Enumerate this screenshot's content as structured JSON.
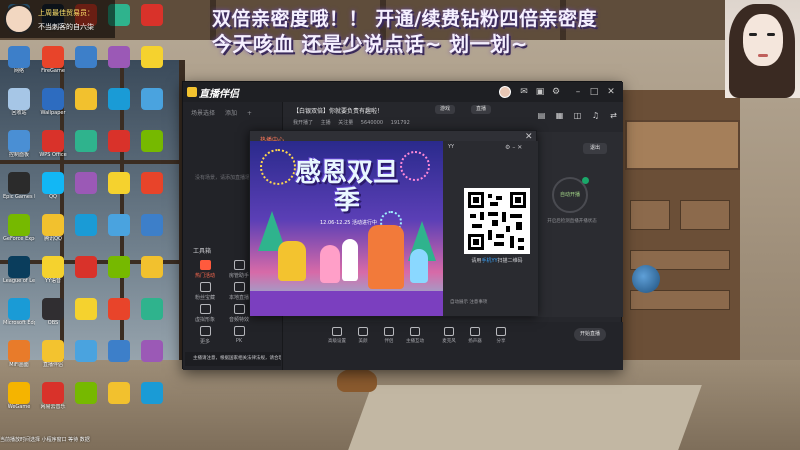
{
  "overlay": {
    "streamer_line1": "上周最佳贸易员：",
    "streamer_line2": "不当刺客的自六柒",
    "headline1": "双倍亲密度哦！！ 开通/续费钻粉四倍亲密度",
    "headline2": "今天咳血 还是少说点话~ 划一划~"
  },
  "desktop_icons": [
    {
      "label": "此电脑",
      "color": "#4aa3df"
    },
    {
      "label": "网络",
      "color": "#3d7fc9"
    },
    {
      "label": "回收站",
      "color": "#a6c6e6"
    },
    {
      "label": "控制面板",
      "color": "#4a8fd4"
    },
    {
      "label": "Epic Games Launcher",
      "color": "#2b2b2b"
    },
    {
      "label": "GeForce Experience",
      "color": "#76b900"
    },
    {
      "label": "League of Legends",
      "color": "#0a3d5c"
    },
    {
      "label": "Microsoft Edge",
      "color": "#1a9bd6"
    },
    {
      "label": "MiFi画面",
      "color": "#e87b2a"
    },
    {
      "label": "WeGame",
      "color": "#f5b400"
    },
    {
      "label": "Steam",
      "color": "#1b2838"
    },
    {
      "label": "FireGame",
      "color": "#e8442a"
    },
    {
      "label": "Wallpaper",
      "color": "#2d6cc0"
    },
    {
      "label": "WPS Office",
      "color": "#d9322a"
    },
    {
      "label": "QQ",
      "color": "#12b7f5"
    },
    {
      "label": "腾讯QQ",
      "color": "#f2c12e"
    },
    {
      "label": "YY语音",
      "color": "#f5d22e"
    },
    {
      "label": "OBS",
      "color": "#302e31"
    },
    {
      "label": "直播伴侣",
      "color": "#f3c32f"
    },
    {
      "label": "网易云音乐",
      "color": "#d9322a"
    }
  ],
  "app": {
    "title": "直播伴侣",
    "left_tabs": [
      "场景选择",
      "添加",
      "+"
    ],
    "empty_hint": "没有场景，请添加直播场景",
    "tools_title": "工具箱",
    "tools": [
      {
        "label": "热门活动",
        "highlight": true
      },
      {
        "label": "房管助手",
        "highlight": false
      },
      {
        "label": "粉丝宝藏",
        "highlight": false
      },
      {
        "label": "本地直播",
        "highlight": false
      },
      {
        "label": "虚拟形象",
        "highlight": false
      },
      {
        "label": "音频特效",
        "highlight": false
      },
      {
        "label": "更多",
        "highlight": false
      },
      {
        "label": "PK",
        "highlight": false
      }
    ],
    "notice": "主播请注意，根据国家相关法律法规，请合理直播与直播",
    "room": {
      "name": "【白银双倍】你就要负责有趣啦！",
      "pill_category": "游戏",
      "pill_edit": "直播",
      "stats": [
        "我开播了",
        "主播 ",
        "关注量 ",
        "5640000",
        "191792"
      ]
    },
    "exit_label": "退出",
    "autogo": "自动开播",
    "autogo_desc": "开启后检测直播开播状态",
    "bottom_items": [
      "高级设置",
      "美颜",
      "伴侣",
      "主播互动",
      "麦克风",
      "扬声器",
      "分享"
    ],
    "golive": "开始直播"
  },
  "popup": {
    "title": "热播中心",
    "banner_title": "感恩双旦季",
    "banner_sub": "12.06-12.25 活动进行中",
    "qr_title": "YY",
    "qr_caption_prefix": "请用",
    "qr_caption_hl": "手机YY",
    "qr_caption_suffix": "扫描二维码",
    "qr_bottom": "自动展示  注意事项"
  },
  "taskbar_hint": "当前播放时间选择  小程序窗口  等待  数据"
}
